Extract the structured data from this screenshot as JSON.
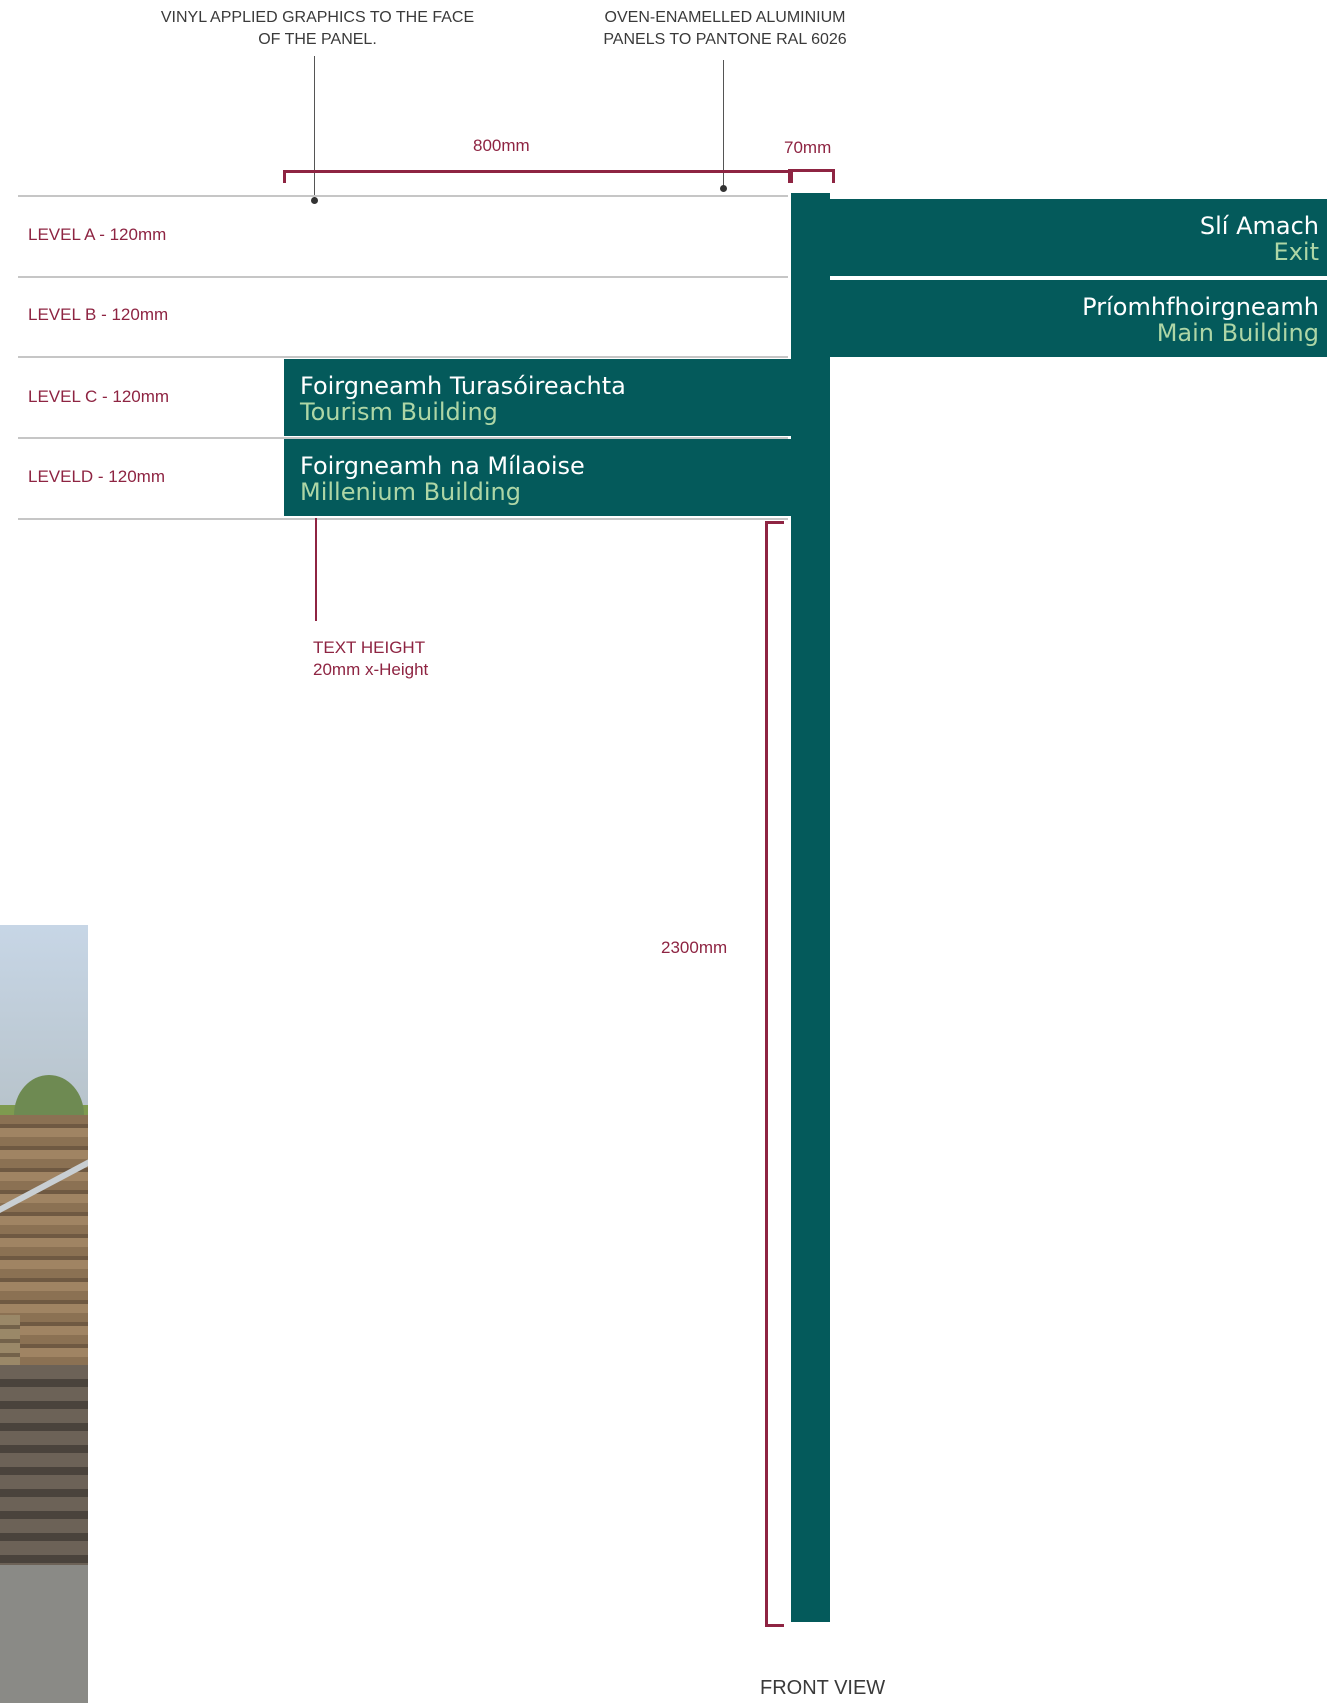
{
  "notes": {
    "vinyl": "VINYL APPLIED GRAPHICS TO THE FACE OF THE PANEL.",
    "aluminium": "OVEN-ENAMELLED ALUMINIUM PANELS TO PANTONE RAL 6026",
    "text_height": "TEXT HEIGHT\n20mm x-Height",
    "front_view": "FRONT VIEW"
  },
  "dimensions": {
    "panel_width": "800mm",
    "post_width": "70mm",
    "post_height": "2300mm"
  },
  "levels": [
    {
      "label": "LEVEL A - 120mm"
    },
    {
      "label": "LEVEL B - 120mm"
    },
    {
      "label": "LEVEL C - 120mm"
    },
    {
      "label": "LEVELD - 120mm"
    }
  ],
  "signs": {
    "right": [
      {
        "irish": "Slí Amach",
        "english": "Exit"
      },
      {
        "irish": "Príomhfhoirgneamh",
        "english": "Main Building"
      }
    ],
    "left": [
      {
        "irish": "Foirgneamh Turasóireachta",
        "english": "Tourism Building"
      },
      {
        "irish": "Foirgneamh na Mílaoise",
        "english": "Millenium Building"
      }
    ]
  },
  "colors": {
    "panel_green": "#045a5b",
    "english_text": "#aed6a6",
    "dimension_red": "#8e2442"
  }
}
